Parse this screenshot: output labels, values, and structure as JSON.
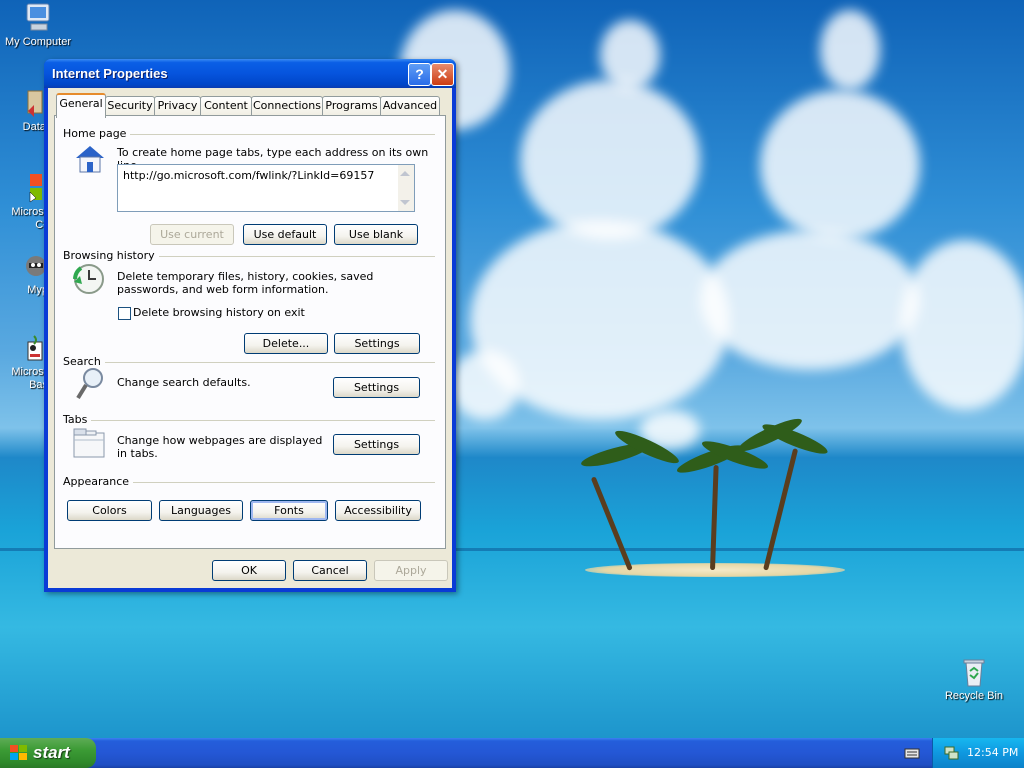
{
  "desktop": {
    "icons": [
      {
        "label": "My Computer"
      },
      {
        "label": "DataWa"
      },
      {
        "label": "Microsoft\nC++"
      },
      {
        "label": "Myp"
      },
      {
        "label": "Microsoft\nBasic"
      },
      {
        "label": "Recycle Bin"
      }
    ]
  },
  "dialog": {
    "title": "Internet Properties",
    "help_glyph": "?",
    "close_glyph": "✕",
    "tabs": [
      "General",
      "Security",
      "Privacy",
      "Content",
      "Connections",
      "Programs",
      "Advanced"
    ],
    "active_tab": "General",
    "home_page": {
      "group_label": "Home page",
      "description": "To create home page tabs, type each address on its own line.",
      "url": "http://go.microsoft.com/fwlink/?LinkId=69157",
      "use_current": "Use current",
      "use_default": "Use default",
      "use_blank": "Use blank"
    },
    "browsing_history": {
      "group_label": "Browsing history",
      "description": "Delete temporary files, history, cookies, saved passwords, and web form information.",
      "checkbox_label": "Delete browsing history on exit",
      "checkbox_checked": false,
      "delete_button": "Delete...",
      "settings_button": "Settings"
    },
    "search": {
      "group_label": "Search",
      "description": "Change search defaults.",
      "settings_button": "Settings"
    },
    "tabs_section": {
      "group_label": "Tabs",
      "description": "Change how webpages are displayed in tabs.",
      "settings_button": "Settings"
    },
    "appearance": {
      "group_label": "Appearance",
      "colors": "Colors",
      "languages": "Languages",
      "fonts": "Fonts",
      "accessibility": "Accessibility"
    },
    "footer": {
      "ok": "OK",
      "cancel": "Cancel",
      "apply": "Apply"
    }
  },
  "taskbar": {
    "start_label": "start",
    "clock": "12:54 PM"
  },
  "colors": {
    "title_bar": "#0654dd",
    "dialog_face": "#ece9d8",
    "taskbar": "#245edb",
    "start_button": "#3c9b35"
  }
}
